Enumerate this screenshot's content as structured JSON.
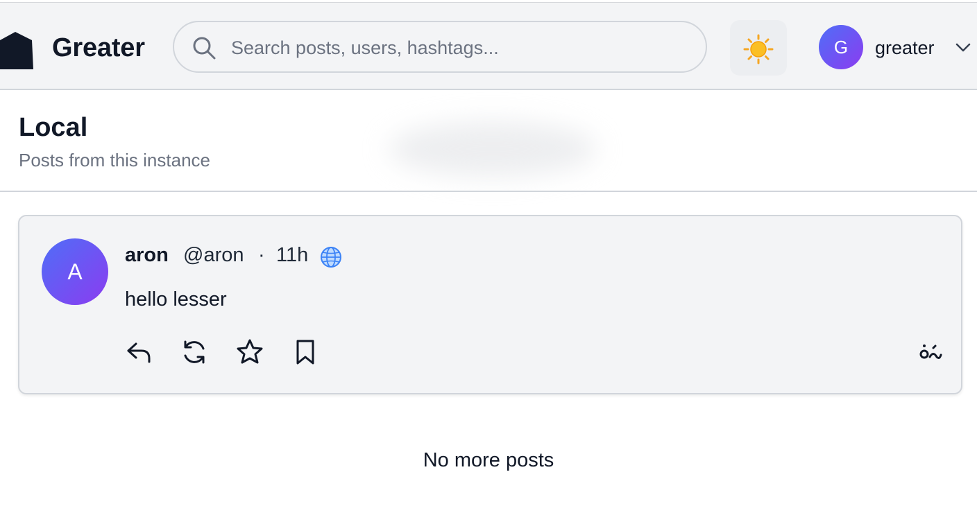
{
  "header": {
    "brand": "Greater",
    "search": {
      "placeholder": "Search posts, users, hashtags...",
      "value": ""
    },
    "theme_icon": "sun-icon",
    "user": {
      "initial": "G",
      "name": "greater"
    }
  },
  "page": {
    "title": "Local",
    "subtitle": "Posts from this instance"
  },
  "posts": [
    {
      "avatar_initial": "A",
      "display_name": "aron",
      "handle": "@aron",
      "separator": "·",
      "time": "11h",
      "visibility_icon": "globe-icon",
      "content": "hello lesser",
      "actions": [
        "reply-icon",
        "boost-icon",
        "favorite-icon",
        "bookmark-icon",
        "more-icon"
      ]
    }
  ],
  "feed_end": "No more posts",
  "colors": {
    "accent_gradient_start": "#4f6ef7",
    "accent_gradient_end": "#8b3cf0",
    "header_bg": "#f3f4f6",
    "muted_text": "#6b7280"
  }
}
